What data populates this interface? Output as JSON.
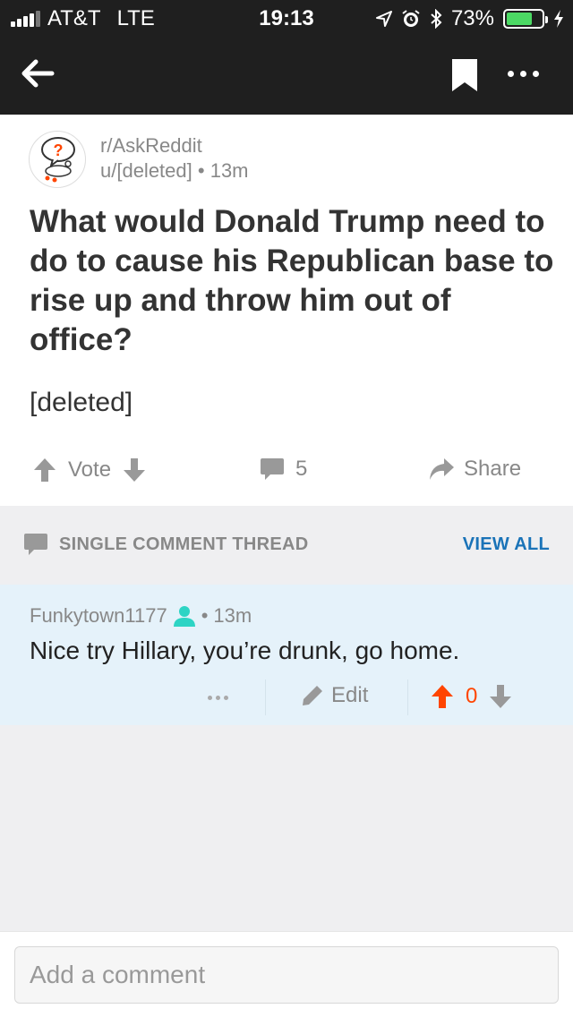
{
  "status_bar": {
    "carrier": "AT&T",
    "network": "LTE",
    "time": "19:13",
    "battery": "73%",
    "battery_level": 0.73
  },
  "post": {
    "subreddit": "r/AskReddit",
    "author": "u/[deleted]",
    "age": "13m",
    "separator": "•",
    "title": "What would Donald Trump need to do to cause his Republican base to rise up and throw him out of office?",
    "body": "[deleted]",
    "vote_label": "Vote",
    "comment_count": "5",
    "share_label": "Share"
  },
  "thread_bar": {
    "label": "SINGLE COMMENT THREAD",
    "view_all": "VIEW ALL"
  },
  "comment": {
    "author": "Funkytown1177",
    "separator": "•",
    "age": "13m",
    "text": "Nice try Hillary, you’re drunk, go home.",
    "edit_label": "Edit",
    "score": "0"
  },
  "composer": {
    "placeholder": "Add a comment"
  },
  "colors": {
    "header_bg": "#1f1f1f",
    "accent_blue": "#1a73b8",
    "upvote_orange": "#ff4500",
    "comment_bg": "#e5f2fa",
    "op_icon": "#2dd4c4"
  }
}
